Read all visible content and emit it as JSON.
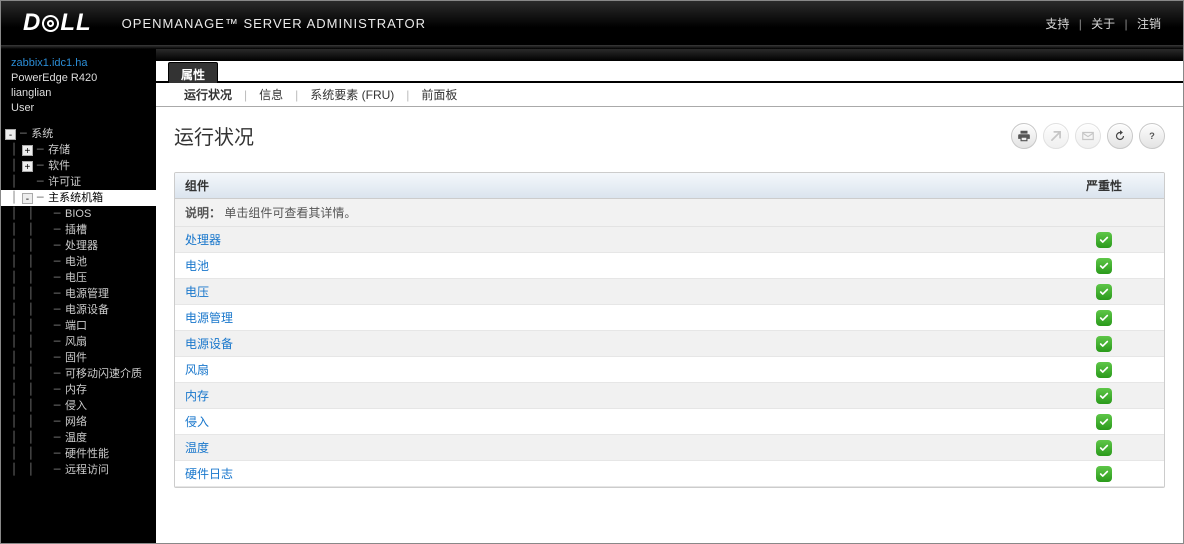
{
  "header": {
    "brand": "DELL",
    "product": "OPENMANAGE™ SERVER ADMINISTRATOR",
    "links": {
      "support": "支持",
      "about": "关于",
      "logout": "注销"
    }
  },
  "sidebar": {
    "host": "zabbix1.idc1.ha",
    "model": "PowerEdge R420",
    "user1": "lianglian",
    "user2": "User",
    "tree": [
      {
        "depth": 0,
        "toggle": "-",
        "label": "系统",
        "sel": false
      },
      {
        "depth": 1,
        "toggle": "+",
        "label": "存储",
        "sel": false
      },
      {
        "depth": 1,
        "toggle": "+",
        "label": "软件",
        "sel": false
      },
      {
        "depth": 1,
        "toggle": "",
        "label": "许可证",
        "sel": false
      },
      {
        "depth": 1,
        "toggle": "-",
        "label": "主系统机箱",
        "sel": true
      },
      {
        "depth": 2,
        "toggle": "",
        "label": "BIOS",
        "sel": false
      },
      {
        "depth": 2,
        "toggle": "",
        "label": "插槽",
        "sel": false
      },
      {
        "depth": 2,
        "toggle": "",
        "label": "处理器",
        "sel": false
      },
      {
        "depth": 2,
        "toggle": "",
        "label": "电池",
        "sel": false
      },
      {
        "depth": 2,
        "toggle": "",
        "label": "电压",
        "sel": false
      },
      {
        "depth": 2,
        "toggle": "",
        "label": "电源管理",
        "sel": false
      },
      {
        "depth": 2,
        "toggle": "",
        "label": "电源设备",
        "sel": false
      },
      {
        "depth": 2,
        "toggle": "",
        "label": "端口",
        "sel": false
      },
      {
        "depth": 2,
        "toggle": "",
        "label": "风扇",
        "sel": false
      },
      {
        "depth": 2,
        "toggle": "",
        "label": "固件",
        "sel": false
      },
      {
        "depth": 2,
        "toggle": "",
        "label": "可移动闪速介质",
        "sel": false
      },
      {
        "depth": 2,
        "toggle": "",
        "label": "内存",
        "sel": false
      },
      {
        "depth": 2,
        "toggle": "",
        "label": "侵入",
        "sel": false
      },
      {
        "depth": 2,
        "toggle": "",
        "label": "网络",
        "sel": false
      },
      {
        "depth": 2,
        "toggle": "",
        "label": "温度",
        "sel": false
      },
      {
        "depth": 2,
        "toggle": "",
        "label": "硬件性能",
        "sel": false
      },
      {
        "depth": 2,
        "toggle": "",
        "label": "远程访问",
        "sel": false
      }
    ]
  },
  "tabs1": {
    "active": "属性"
  },
  "tabs2": {
    "active": "运行状况",
    "items": [
      "运行状况",
      "信息",
      "系统要素 (FRU)",
      "前面板"
    ]
  },
  "page": {
    "title": "运行状况",
    "note_label": "说明：",
    "note_text": "单击组件可查看其详情。",
    "columns": {
      "component": "组件",
      "severity": "严重性"
    },
    "rows": [
      {
        "label": "处理器",
        "status": "ok"
      },
      {
        "label": "电池",
        "status": "ok"
      },
      {
        "label": "电压",
        "status": "ok"
      },
      {
        "label": "电源管理",
        "status": "ok"
      },
      {
        "label": "电源设备",
        "status": "ok"
      },
      {
        "label": "风扇",
        "status": "ok"
      },
      {
        "label": "内存",
        "status": "ok"
      },
      {
        "label": "侵入",
        "status": "ok"
      },
      {
        "label": "温度",
        "status": "ok"
      },
      {
        "label": "硬件日志",
        "status": "ok"
      }
    ]
  },
  "toolbar": {
    "print": "print",
    "export": "export",
    "email": "email",
    "refresh": "refresh",
    "help": "help"
  }
}
